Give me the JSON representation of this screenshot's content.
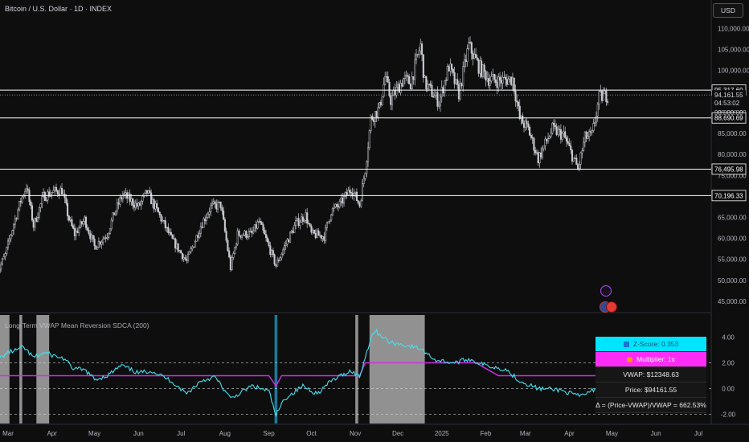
{
  "header": {
    "title": "Bitcoin / U.S. Dollar · 1D · INDEX",
    "currency_button": "USD"
  },
  "chart_data": {
    "type": "candlestick",
    "title": "Bitcoin / U.S. Dollar · 1D · INDEX",
    "price_axis": {
      "ticks": [
        45000,
        50000,
        55000,
        60000,
        65000,
        70000,
        75000,
        80000,
        85000,
        90000,
        95000,
        100000,
        105000,
        110000
      ],
      "tick_labels": [
        "45,000.00",
        "50,000.00",
        "55,000.00",
        "60,000.00",
        "65,000.00",
        "70,000.00",
        "75,000.00",
        "80,000.00",
        "85,000.00",
        "90,000.00",
        "95,000.00",
        "100,000.00",
        "105,000.00",
        "110,000.00"
      ],
      "range": [
        42500,
        112000
      ]
    },
    "x_axis": {
      "tick_labels": [
        "Mar",
        "Apr",
        "May",
        "Jun",
        "Jul",
        "Aug",
        "Sep",
        "Oct",
        "Nov",
        "Dec",
        "2025",
        "Feb",
        "Mar",
        "Apr",
        "May",
        "Jun",
        "Jul"
      ],
      "tick_dates": [
        "2024-03-01",
        "2024-04-01",
        "2024-05-01",
        "2024-06-01",
        "2024-07-01",
        "2024-08-01",
        "2024-09-01",
        "2024-10-01",
        "2024-11-01",
        "2024-12-01",
        "2025-01-01",
        "2025-02-01",
        "2025-03-01",
        "2025-04-01",
        "2025-05-01",
        "2025-06-01",
        "2025-07-01"
      ]
    },
    "close_series": [
      [
        "2024-02-22",
        51500
      ],
      [
        "2024-02-28",
        56000
      ],
      [
        "2024-03-05",
        63500
      ],
      [
        "2024-03-10",
        69000
      ],
      [
        "2024-03-14",
        72500
      ],
      [
        "2024-03-19",
        63000
      ],
      [
        "2024-03-26",
        70000
      ],
      [
        "2024-04-01",
        71000
      ],
      [
        "2024-04-08",
        71500
      ],
      [
        "2024-04-13",
        64500
      ],
      [
        "2024-04-17",
        61000
      ],
      [
        "2024-04-24",
        64500
      ],
      [
        "2024-05-01",
        58000
      ],
      [
        "2024-05-10",
        61000
      ],
      [
        "2024-05-15",
        66000
      ],
      [
        "2024-05-21",
        70500
      ],
      [
        "2024-06-01",
        67500
      ],
      [
        "2024-06-07",
        71000
      ],
      [
        "2024-06-15",
        66000
      ],
      [
        "2024-06-24",
        60000
      ],
      [
        "2024-07-05",
        54500
      ],
      [
        "2024-07-15",
        63000
      ],
      [
        "2024-07-22",
        67500
      ],
      [
        "2024-07-29",
        68000
      ],
      [
        "2024-08-05",
        53000
      ],
      [
        "2024-08-10",
        61000
      ],
      [
        "2024-08-20",
        61000
      ],
      [
        "2024-08-25",
        64000
      ],
      [
        "2024-09-01",
        58000
      ],
      [
        "2024-09-06",
        53500
      ],
      [
        "2024-09-12",
        58000
      ],
      [
        "2024-09-20",
        63500
      ],
      [
        "2024-09-27",
        65500
      ],
      [
        "2024-10-01",
        61000
      ],
      [
        "2024-10-10",
        60500
      ],
      [
        "2024-10-15",
        66500
      ],
      [
        "2024-10-21",
        68000
      ],
      [
        "2024-10-29",
        72000
      ],
      [
        "2024-11-04",
        68000
      ],
      [
        "2024-11-08",
        76500
      ],
      [
        "2024-11-12",
        88500
      ],
      [
        "2024-11-18",
        91000
      ],
      [
        "2024-11-22",
        98500
      ],
      [
        "2024-11-26",
        93000
      ],
      [
        "2024-12-05",
        98000
      ],
      [
        "2024-12-10",
        97000
      ],
      [
        "2024-12-17",
        106000
      ],
      [
        "2024-12-20",
        97000
      ],
      [
        "2024-12-30",
        92500
      ],
      [
        "2025-01-06",
        101000
      ],
      [
        "2025-01-13",
        94500
      ],
      [
        "2025-01-20",
        106000
      ],
      [
        "2025-01-27",
        101000
      ],
      [
        "2025-02-03",
        98000
      ],
      [
        "2025-02-10",
        97500
      ],
      [
        "2025-02-20",
        98000
      ],
      [
        "2025-02-25",
        88500
      ],
      [
        "2025-03-03",
        86000
      ],
      [
        "2025-03-10",
        79000
      ],
      [
        "2025-03-20",
        86000
      ],
      [
        "2025-03-28",
        84500
      ],
      [
        "2025-04-07",
        76500
      ],
      [
        "2025-04-12",
        84000
      ],
      [
        "2025-04-17",
        84500
      ],
      [
        "2025-04-22",
        93500
      ],
      [
        "2025-04-28",
        94160
      ]
    ],
    "horizontal_levels": [
      {
        "value": 95317.6,
        "label": "95,317.60"
      },
      {
        "value": 88690.69,
        "label": "88,690.69"
      },
      {
        "value": 76495.98,
        "label": "76,495.98"
      },
      {
        "value": 70196.33,
        "label": "70,196.33"
      }
    ],
    "last_price": {
      "value": 94161.55,
      "label": "94,161.55",
      "countdown": "04:53:02"
    },
    "partial_tick_label": "90,000.00",
    "indicator": {
      "name": "Long-Term VWAP Mean Reversion SDCA (200)",
      "y_ticks": [
        4.0,
        2.0,
        0.0,
        -2.0
      ],
      "y_tick_labels": [
        "4.00",
        "2.00",
        "0.00",
        "-2.00"
      ],
      "range": [
        -2.5,
        4.7
      ],
      "dashed_levels": [
        2.0,
        0.0,
        -2.0
      ],
      "z_score": [
        [
          "2024-02-22",
          2.2
        ],
        [
          "2024-03-01",
          2.8
        ],
        [
          "2024-03-07",
          3.0
        ],
        [
          "2024-03-12",
          3.2
        ],
        [
          "2024-03-19",
          2.4
        ],
        [
          "2024-03-27",
          2.8
        ],
        [
          "2024-04-01",
          2.6
        ],
        [
          "2024-04-10",
          2.3
        ],
        [
          "2024-04-15",
          1.6
        ],
        [
          "2024-04-25",
          1.4
        ],
        [
          "2024-05-01",
          0.7
        ],
        [
          "2024-05-10",
          1.0
        ],
        [
          "2024-05-20",
          1.8
        ],
        [
          "2024-06-01",
          1.2
        ],
        [
          "2024-06-10",
          1.4
        ],
        [
          "2024-06-24",
          0.6
        ],
        [
          "2024-07-05",
          -0.4
        ],
        [
          "2024-07-15",
          0.6
        ],
        [
          "2024-07-25",
          0.9
        ],
        [
          "2024-08-05",
          -0.8
        ],
        [
          "2024-08-20",
          0.2
        ],
        [
          "2024-09-01",
          -0.2
        ],
        [
          "2024-09-06",
          -2.1
        ],
        [
          "2024-09-12",
          -0.8
        ],
        [
          "2024-09-25",
          0.2
        ],
        [
          "2024-10-05",
          -0.4
        ],
        [
          "2024-10-15",
          0.6
        ],
        [
          "2024-10-29",
          1.4
        ],
        [
          "2024-11-04",
          0.9
        ],
        [
          "2024-11-12",
          4.0
        ],
        [
          "2024-11-15",
          4.5
        ],
        [
          "2024-11-25",
          3.6
        ],
        [
          "2024-12-05",
          3.4
        ],
        [
          "2024-12-17",
          3.1
        ],
        [
          "2024-12-28",
          2.2
        ],
        [
          "2025-01-10",
          2.0
        ],
        [
          "2025-01-20",
          2.3
        ],
        [
          "2025-02-01",
          1.8
        ],
        [
          "2025-02-15",
          1.5
        ],
        [
          "2025-02-25",
          0.6
        ],
        [
          "2025-03-10",
          0.0
        ],
        [
          "2025-03-25",
          -0.1
        ],
        [
          "2025-04-08",
          -0.6
        ],
        [
          "2025-04-15",
          -0.3
        ],
        [
          "2025-04-22",
          0.2
        ],
        [
          "2025-04-28",
          0.35
        ]
      ],
      "multiplier_line": [
        [
          "2024-02-22",
          1.0
        ],
        [
          "2024-03-10",
          1.0
        ],
        [
          "2024-05-01",
          1.0
        ],
        [
          "2024-06-20",
          1.0
        ],
        [
          "2024-07-05",
          1.0
        ],
        [
          "2024-08-05",
          1.0
        ],
        [
          "2024-08-20",
          1.0
        ],
        [
          "2024-09-01",
          1.0
        ],
        [
          "2024-09-06",
          0.2
        ],
        [
          "2024-09-10",
          1.0
        ],
        [
          "2024-10-20",
          1.0
        ],
        [
          "2024-11-04",
          1.0
        ],
        [
          "2024-11-08",
          2.0
        ],
        [
          "2025-01-25",
          2.0
        ],
        [
          "2025-02-10",
          1.0
        ],
        [
          "2025-04-28",
          1.0
        ]
      ],
      "shaded_periods": [
        {
          "start": "2024-02-22",
          "end": "2024-03-02"
        },
        {
          "start": "2024-03-09",
          "end": "2024-03-11"
        },
        {
          "start": "2024-03-21",
          "end": "2024-03-30"
        },
        {
          "start": "2024-11-01",
          "end": "2024-11-03"
        },
        {
          "start": "2024-11-11",
          "end": "2024-12-20"
        }
      ],
      "highlight_periods": [
        {
          "start": "2024-09-05",
          "end": "2024-09-07"
        }
      ]
    }
  },
  "stats_table": {
    "z_score": "Z-Score: 0.353",
    "multiplier": "Multiplier: 1x",
    "vwap": "VWAP: $12348.63",
    "price": "Price: $94161.55",
    "delta": "Δ = (Price-VWAP)/VWAP = 662.53%"
  },
  "colors": {
    "background": "#0e0e0f",
    "candle": "#c9cbd1",
    "z_line": "#45e0ee",
    "multiplier_line": "#d62be8",
    "shade": "#bdbdbd",
    "highlight": "#1e7fa0"
  }
}
